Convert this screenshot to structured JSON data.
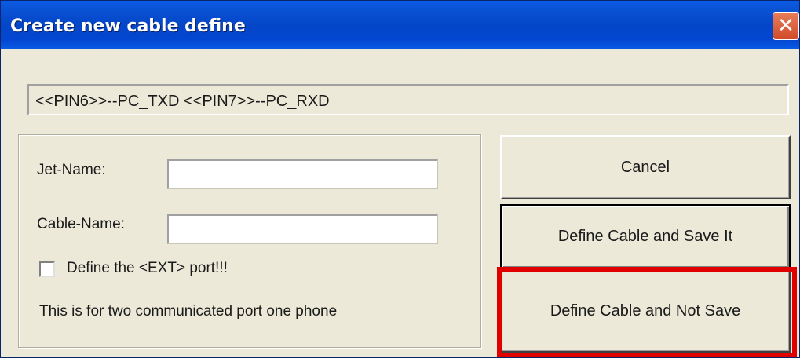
{
  "window": {
    "title": "Create new cable define",
    "close_icon": "close-icon"
  },
  "pin_display": {
    "text": "<<PIN6>>--PC_TXD <<PIN7>>--PC_RXD"
  },
  "form": {
    "jet_name_label": "Jet-Name:",
    "jet_name_value": "",
    "cable_name_label": "Cable-Name:",
    "cable_name_value": "",
    "ext_checkbox_label": "Define the <EXT> port!!!",
    "ext_checkbox_checked": false,
    "info_text": "This is for two communicated port one phone"
  },
  "buttons": {
    "cancel": "Cancel",
    "define_save": "Define Cable and Save It",
    "define_not_save": "Define Cable and Not Save"
  },
  "colors": {
    "titlebar": "#0446c7",
    "highlight": "#e00000",
    "dialog_bg": "#ece9d8"
  }
}
